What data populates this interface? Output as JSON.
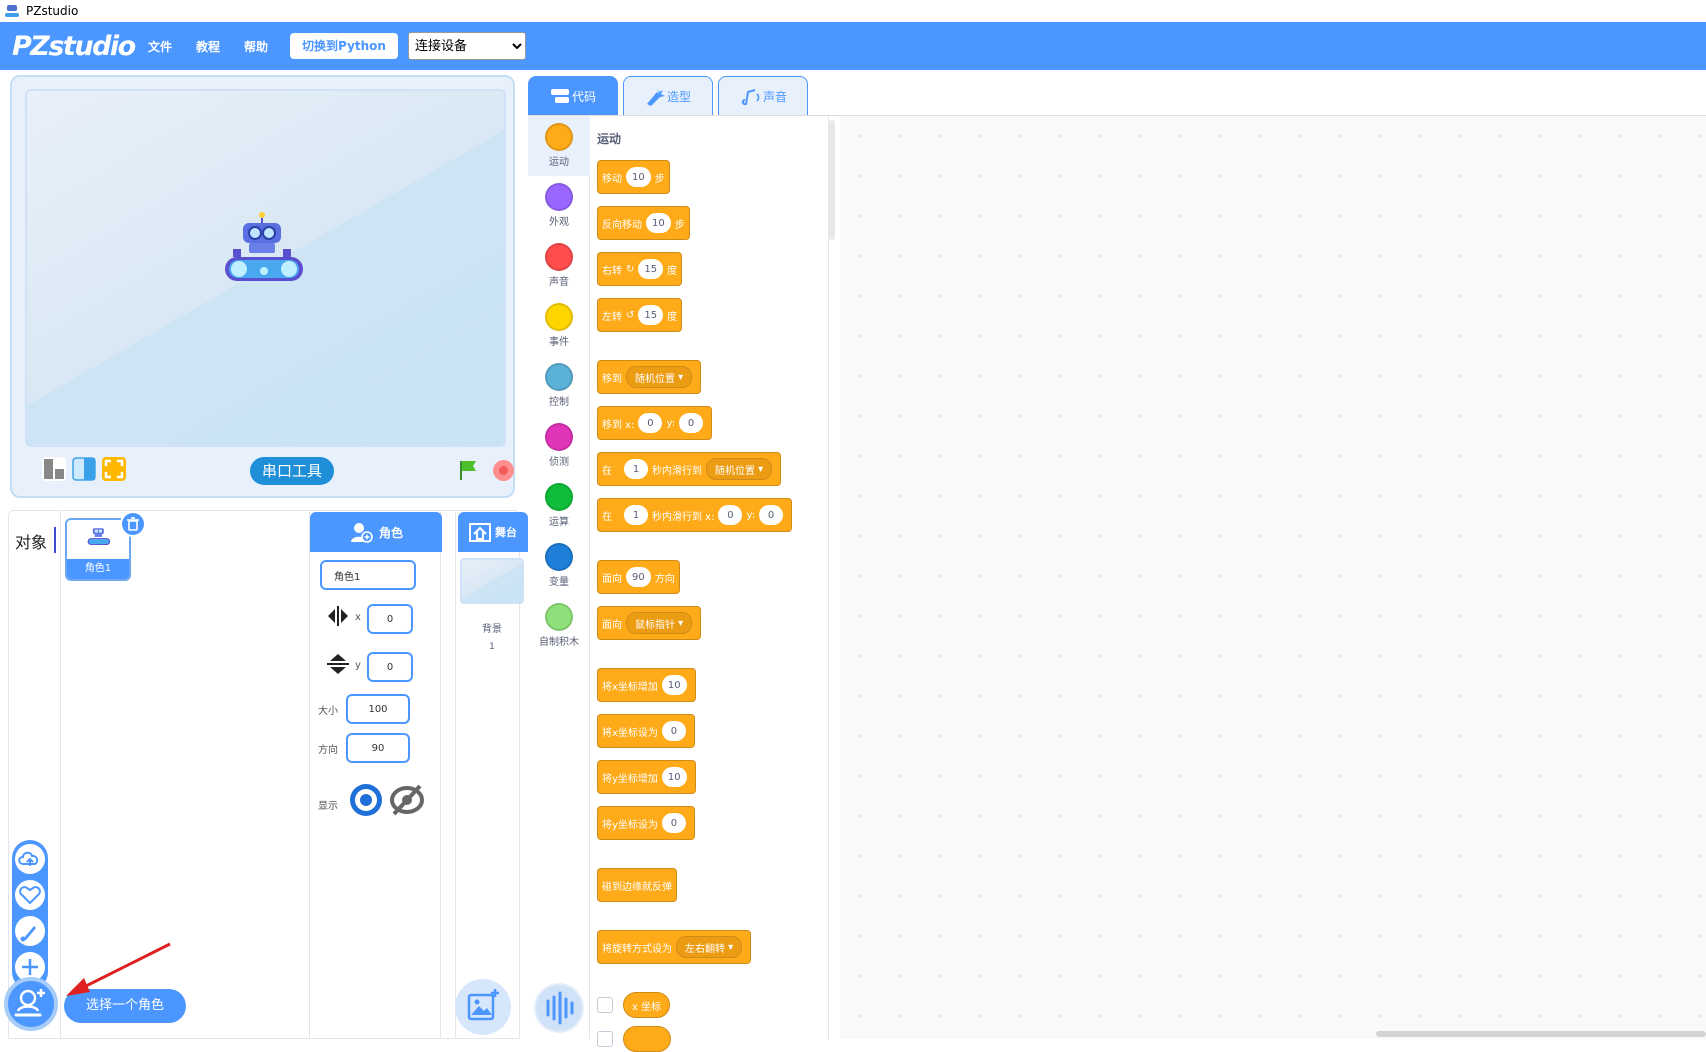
{
  "window": {
    "title": "PZstudio"
  },
  "menubar": {
    "logo": "PZstudio",
    "items": [
      "文件",
      "教程",
      "帮助"
    ],
    "python_button": "切换到Python",
    "device_select": {
      "value": "连接设备",
      "options": [
        "连接设备"
      ]
    },
    "bg_color": "#4c97ff"
  },
  "stage": {
    "serial_tool_button": "串口工具"
  },
  "sprites": {
    "panel_label": "对象",
    "list": [
      {
        "name": "角色1"
      }
    ]
  },
  "sprite_props": {
    "header": "角色",
    "name_value": "角色1",
    "x_label": "x",
    "x_value": "0",
    "y_label": "y",
    "y_value": "0",
    "size_label": "大小",
    "size_value": "100",
    "direction_label": "方向",
    "direction_value": "90",
    "show_label": "显示"
  },
  "stage_panel": {
    "header": "舞台",
    "backdrop_label": "背景",
    "backdrop_count": "1"
  },
  "tooltip": {
    "text": "选择一个角色"
  },
  "tabs": [
    {
      "label": "代码",
      "active": true
    },
    {
      "label": "造型",
      "active": false
    },
    {
      "label": "声音",
      "active": false
    }
  ],
  "categories": [
    {
      "label": "运动",
      "color": "#ffab19"
    },
    {
      "label": "外观",
      "color": "#9966ff"
    },
    {
      "label": "声音",
      "color": "#ff4d4d"
    },
    {
      "label": "事件",
      "color": "#ffd500"
    },
    {
      "label": "控制",
      "color": "#5cb1d6"
    },
    {
      "label": "侦测",
      "color": "#e035b8"
    },
    {
      "label": "运算",
      "color": "#0fbd3a"
    },
    {
      "label": "变量",
      "color": "#1e7fd8"
    },
    {
      "label": "自制积木",
      "color": "#8fe07a"
    }
  ],
  "palette": {
    "title": "运动",
    "blocks": {
      "move": {
        "a": "移动",
        "n": "10",
        "b": "步"
      },
      "move_back": {
        "a": "反向移动",
        "n": "10",
        "b": "步"
      },
      "turn_right": {
        "a": "右转",
        "n": "15",
        "b": "度"
      },
      "turn_left": {
        "a": "左转",
        "n": "15",
        "b": "度"
      },
      "goto": {
        "a": "移到",
        "dd": "随机位置"
      },
      "goto_xy": {
        "a": "移到 x:",
        "x": "0",
        "b": "y:",
        "y": "0"
      },
      "glide": {
        "a": "在",
        "n": "1",
        "b": "秒内滑行到",
        "dd": "随机位置"
      },
      "glide_xy": {
        "a": "在",
        "n": "1",
        "b": "秒内滑行到 x:",
        "x": "0",
        "c": "y:",
        "y": "0"
      },
      "point_dir": {
        "a": "面向",
        "n": "90",
        "b": "方向"
      },
      "point_towards": {
        "a": "面向",
        "dd": "鼠标指针"
      },
      "change_x": {
        "a": "将x坐标增加",
        "n": "10"
      },
      "set_x": {
        "a": "将x坐标设为",
        "n": "0"
      },
      "change_y": {
        "a": "将y坐标增加",
        "n": "10"
      },
      "set_y": {
        "a": "将y坐标设为",
        "n": "0"
      },
      "bounce": {
        "a": "碰到边缘就反弹"
      },
      "rotation_style": {
        "a": "将旋转方式设为",
        "dd": "左右翻转"
      },
      "x_reporter": "x 坐标"
    }
  }
}
